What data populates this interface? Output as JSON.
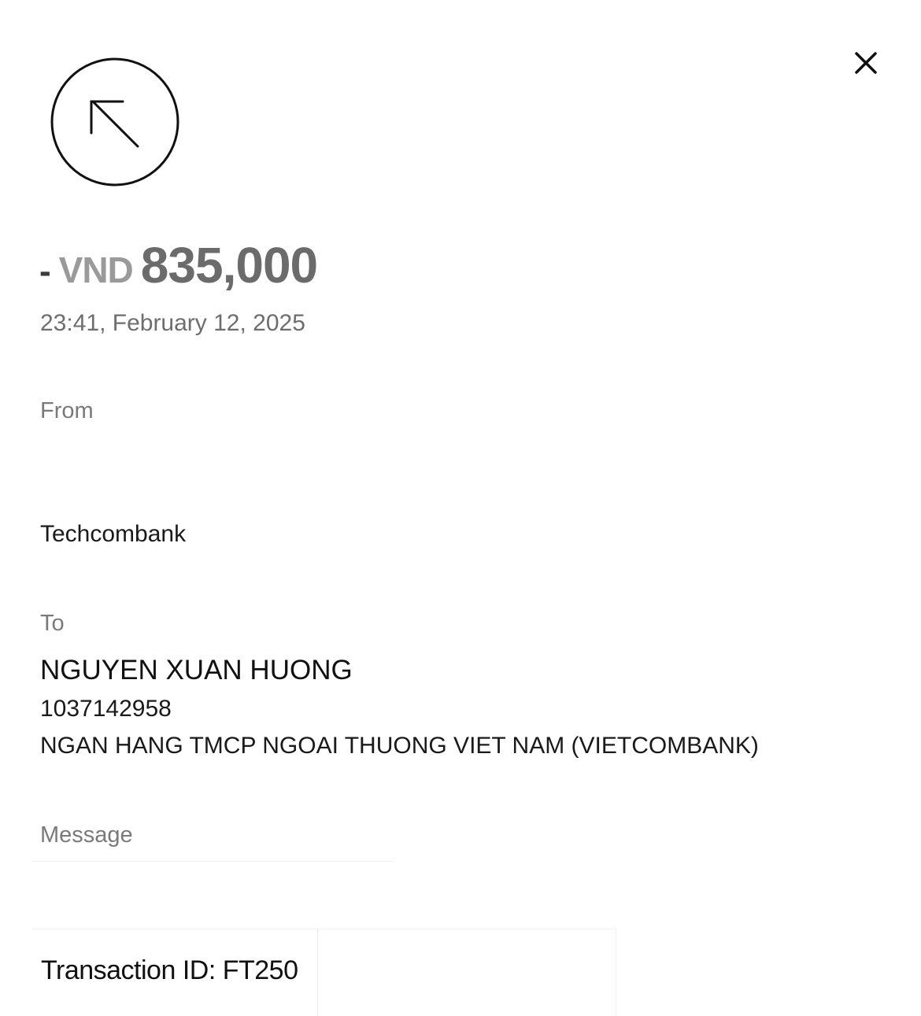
{
  "header": {
    "close_icon": "close-icon",
    "direction_icon": "arrow-up-left-icon"
  },
  "amount": {
    "sign": "-",
    "currency": "VND",
    "value": "835,000"
  },
  "datetime": "23:41, February 12, 2025",
  "from": {
    "label": "From",
    "bank": "Techcombank"
  },
  "to": {
    "label": "To",
    "name": "NGUYEN XUAN HUONG",
    "account": "1037142958",
    "bank": "NGAN HANG TMCP NGOAI THUONG VIET NAM (VIETCOMBANK)"
  },
  "message": {
    "label": "Message"
  },
  "transaction": {
    "id_text": "Transaction ID: FT250"
  },
  "colors": {
    "amount_value": "#6b6b6b",
    "currency": "#9a9a9a",
    "label": "#7a7a7a"
  }
}
